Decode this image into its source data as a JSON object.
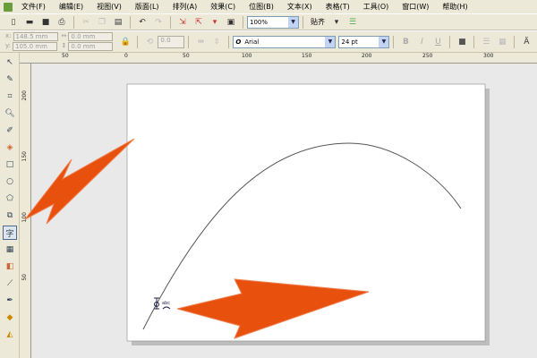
{
  "menu": [
    "文件(F)",
    "编辑(E)",
    "视图(V)",
    "版面(L)",
    "排列(A)",
    "效果(C)",
    "位图(B)",
    "文本(X)",
    "表格(T)",
    "工具(O)",
    "窗口(W)",
    "帮助(H)"
  ],
  "toolbar": {
    "zoom": "100%",
    "snap": "贴齐"
  },
  "property_bar": {
    "x": "148.5 mm",
    "y": "105.0 mm",
    "width": "0.0 mm",
    "height": "0.0 mm",
    "angle": "0.0",
    "font": "Arial",
    "size": "24 pt",
    "x_label": "x:",
    "y_label": "y:"
  },
  "hruler": [
    "50",
    "0",
    "50",
    "100",
    "150",
    "200",
    "250",
    "300"
  ],
  "vruler": [
    "200",
    "150",
    "100",
    "50"
  ],
  "tools": [
    "pick-tool",
    "shape-tool",
    "crop-tool",
    "zoom-tool",
    "freehand-tool",
    "smart-fill-tool",
    "rectangle-tool",
    "ellipse-tool",
    "polygon-tool",
    "basic-shapes-tool",
    "text-tool",
    "table-tool",
    "interactive-blend-tool",
    "eyedropper-tool",
    "outline-tool",
    "fill-tool",
    "interactive-fill-tool"
  ],
  "active_tool": "text-tool",
  "colors": {
    "arrow": "#e8500e"
  }
}
